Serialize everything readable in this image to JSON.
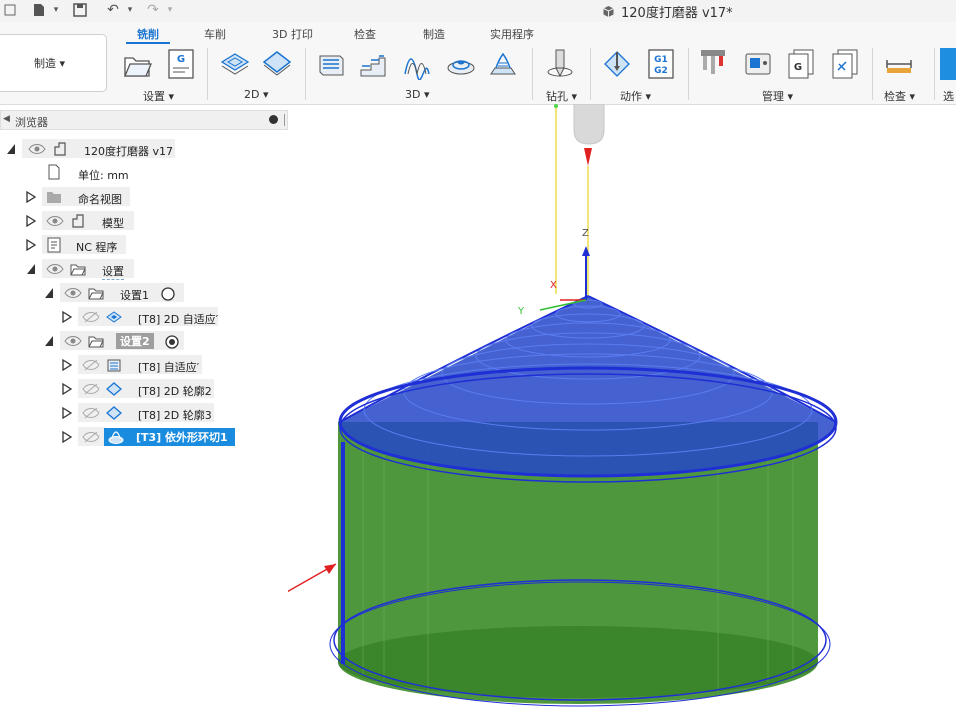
{
  "window": {
    "title": "120度打磨器 v17*"
  },
  "workspace": {
    "label": "制造 ▾"
  },
  "tabs": [
    {
      "label": "铣削",
      "active": true
    },
    {
      "label": "车削"
    },
    {
      "label": "3D 打印"
    },
    {
      "label": "检查"
    },
    {
      "label": "制造"
    },
    {
      "label": "实用程序"
    }
  ],
  "groups": {
    "setup": "设置 ▾",
    "g2d": "2D ▾",
    "g3d": "3D ▾",
    "drill": "钻孔 ▾",
    "actions": "动作 ▾",
    "manage": "管理 ▾",
    "inspect": "检查 ▾",
    "select": "选"
  },
  "browser": {
    "title": "浏览器",
    "root": "120度打磨器 v17",
    "units": "单位: mm",
    "named_views": "命名视图",
    "model": "模型",
    "nc_programs": "NC 程序",
    "setups": "设置",
    "setup1": "设置1",
    "setup1_op1": "[T8] 2D 自适应′",
    "setup2": "设置2",
    "setup2_op1": "[T8] 自适应′",
    "setup2_op2": "[T8] 2D 轮廓2",
    "setup2_op3": "[T8] 2D 轮廓3",
    "setup2_op4": "[T3] 依外形环切1"
  },
  "axes": {
    "z": "Z",
    "x": "X",
    "y": "Y"
  },
  "colors": {
    "accent": "#1a74d1",
    "selection": "#1a8ce0",
    "toolpath": "#1f2fd6",
    "stock": "#3f8e2c",
    "arrow": "#e02020"
  }
}
